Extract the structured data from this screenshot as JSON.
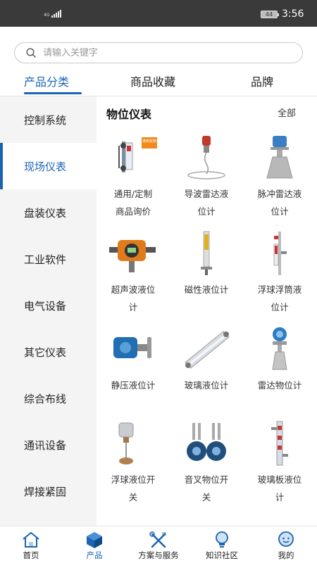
{
  "status_bar": {
    "network": "4G",
    "battery": "44",
    "time": "3:56"
  },
  "search": {
    "placeholder": "请输入关键字"
  },
  "tabs": [
    {
      "label": "产品分类",
      "active": true
    },
    {
      "label": "商品收藏",
      "active": false
    },
    {
      "label": "品牌",
      "active": false
    }
  ],
  "sidebar": {
    "items": [
      {
        "label": "控制系统",
        "active": false
      },
      {
        "label": "现场仪表",
        "active": true
      },
      {
        "label": "盘装仪表",
        "active": false
      },
      {
        "label": "工业软件",
        "active": false
      },
      {
        "label": "电气设备",
        "active": false
      },
      {
        "label": "其它仪表",
        "active": false
      },
      {
        "label": "综合布线",
        "active": false
      },
      {
        "label": "通讯设备",
        "active": false
      },
      {
        "label": "焊接紧固",
        "active": false
      }
    ]
  },
  "main": {
    "section_title": "物位仪表",
    "all_label": "全部",
    "badge_text": "通用定制",
    "products": [
      {
        "name_line1": "通用/定制",
        "name_line2": "商品询价",
        "icon": "custom-inquiry-image"
      },
      {
        "name_line1": "导波雷达液",
        "name_line2": "位计",
        "icon": "guided-wave-radar-image"
      },
      {
        "name_line1": "脉冲雷达液",
        "name_line2": "位计",
        "icon": "pulse-radar-image"
      },
      {
        "name_line1": "超声波液位",
        "name_line2": "计",
        "icon": "ultrasonic-level-image"
      },
      {
        "name_line1": "磁性液位计",
        "name_line2": "",
        "icon": "magnetic-level-image"
      },
      {
        "name_line1": "浮球浮筒液",
        "name_line2": "位计",
        "icon": "float-level-image"
      },
      {
        "name_line1": "静压液位计",
        "name_line2": "",
        "icon": "hydrostatic-level-image"
      },
      {
        "name_line1": "玻璃液位计",
        "name_line2": "",
        "icon": "glass-level-image"
      },
      {
        "name_line1": "雷达物位计",
        "name_line2": "",
        "icon": "radar-level-image"
      },
      {
        "name_line1": "浮球液位开",
        "name_line2": "关",
        "icon": "float-switch-image"
      },
      {
        "name_line1": "音叉物位开",
        "name_line2": "关",
        "icon": "tuning-fork-switch-image"
      },
      {
        "name_line1": "玻璃板液位",
        "name_line2": "计",
        "icon": "glass-plate-level-image"
      }
    ]
  },
  "bottom_nav": [
    {
      "label": "首页",
      "icon": "home-icon",
      "active": false
    },
    {
      "label": "产品",
      "icon": "cube-icon",
      "active": true
    },
    {
      "label": "方案与服务",
      "icon": "tools-icon",
      "active": false
    },
    {
      "label": "知识社区",
      "icon": "lightbulb-icon",
      "active": false
    },
    {
      "label": "我的",
      "icon": "user-icon",
      "active": false
    }
  ],
  "colors": {
    "accent": "#1a64b4",
    "sidebar_bg": "#f4f4f4",
    "status_bar_bg": "#3a3a3a"
  }
}
